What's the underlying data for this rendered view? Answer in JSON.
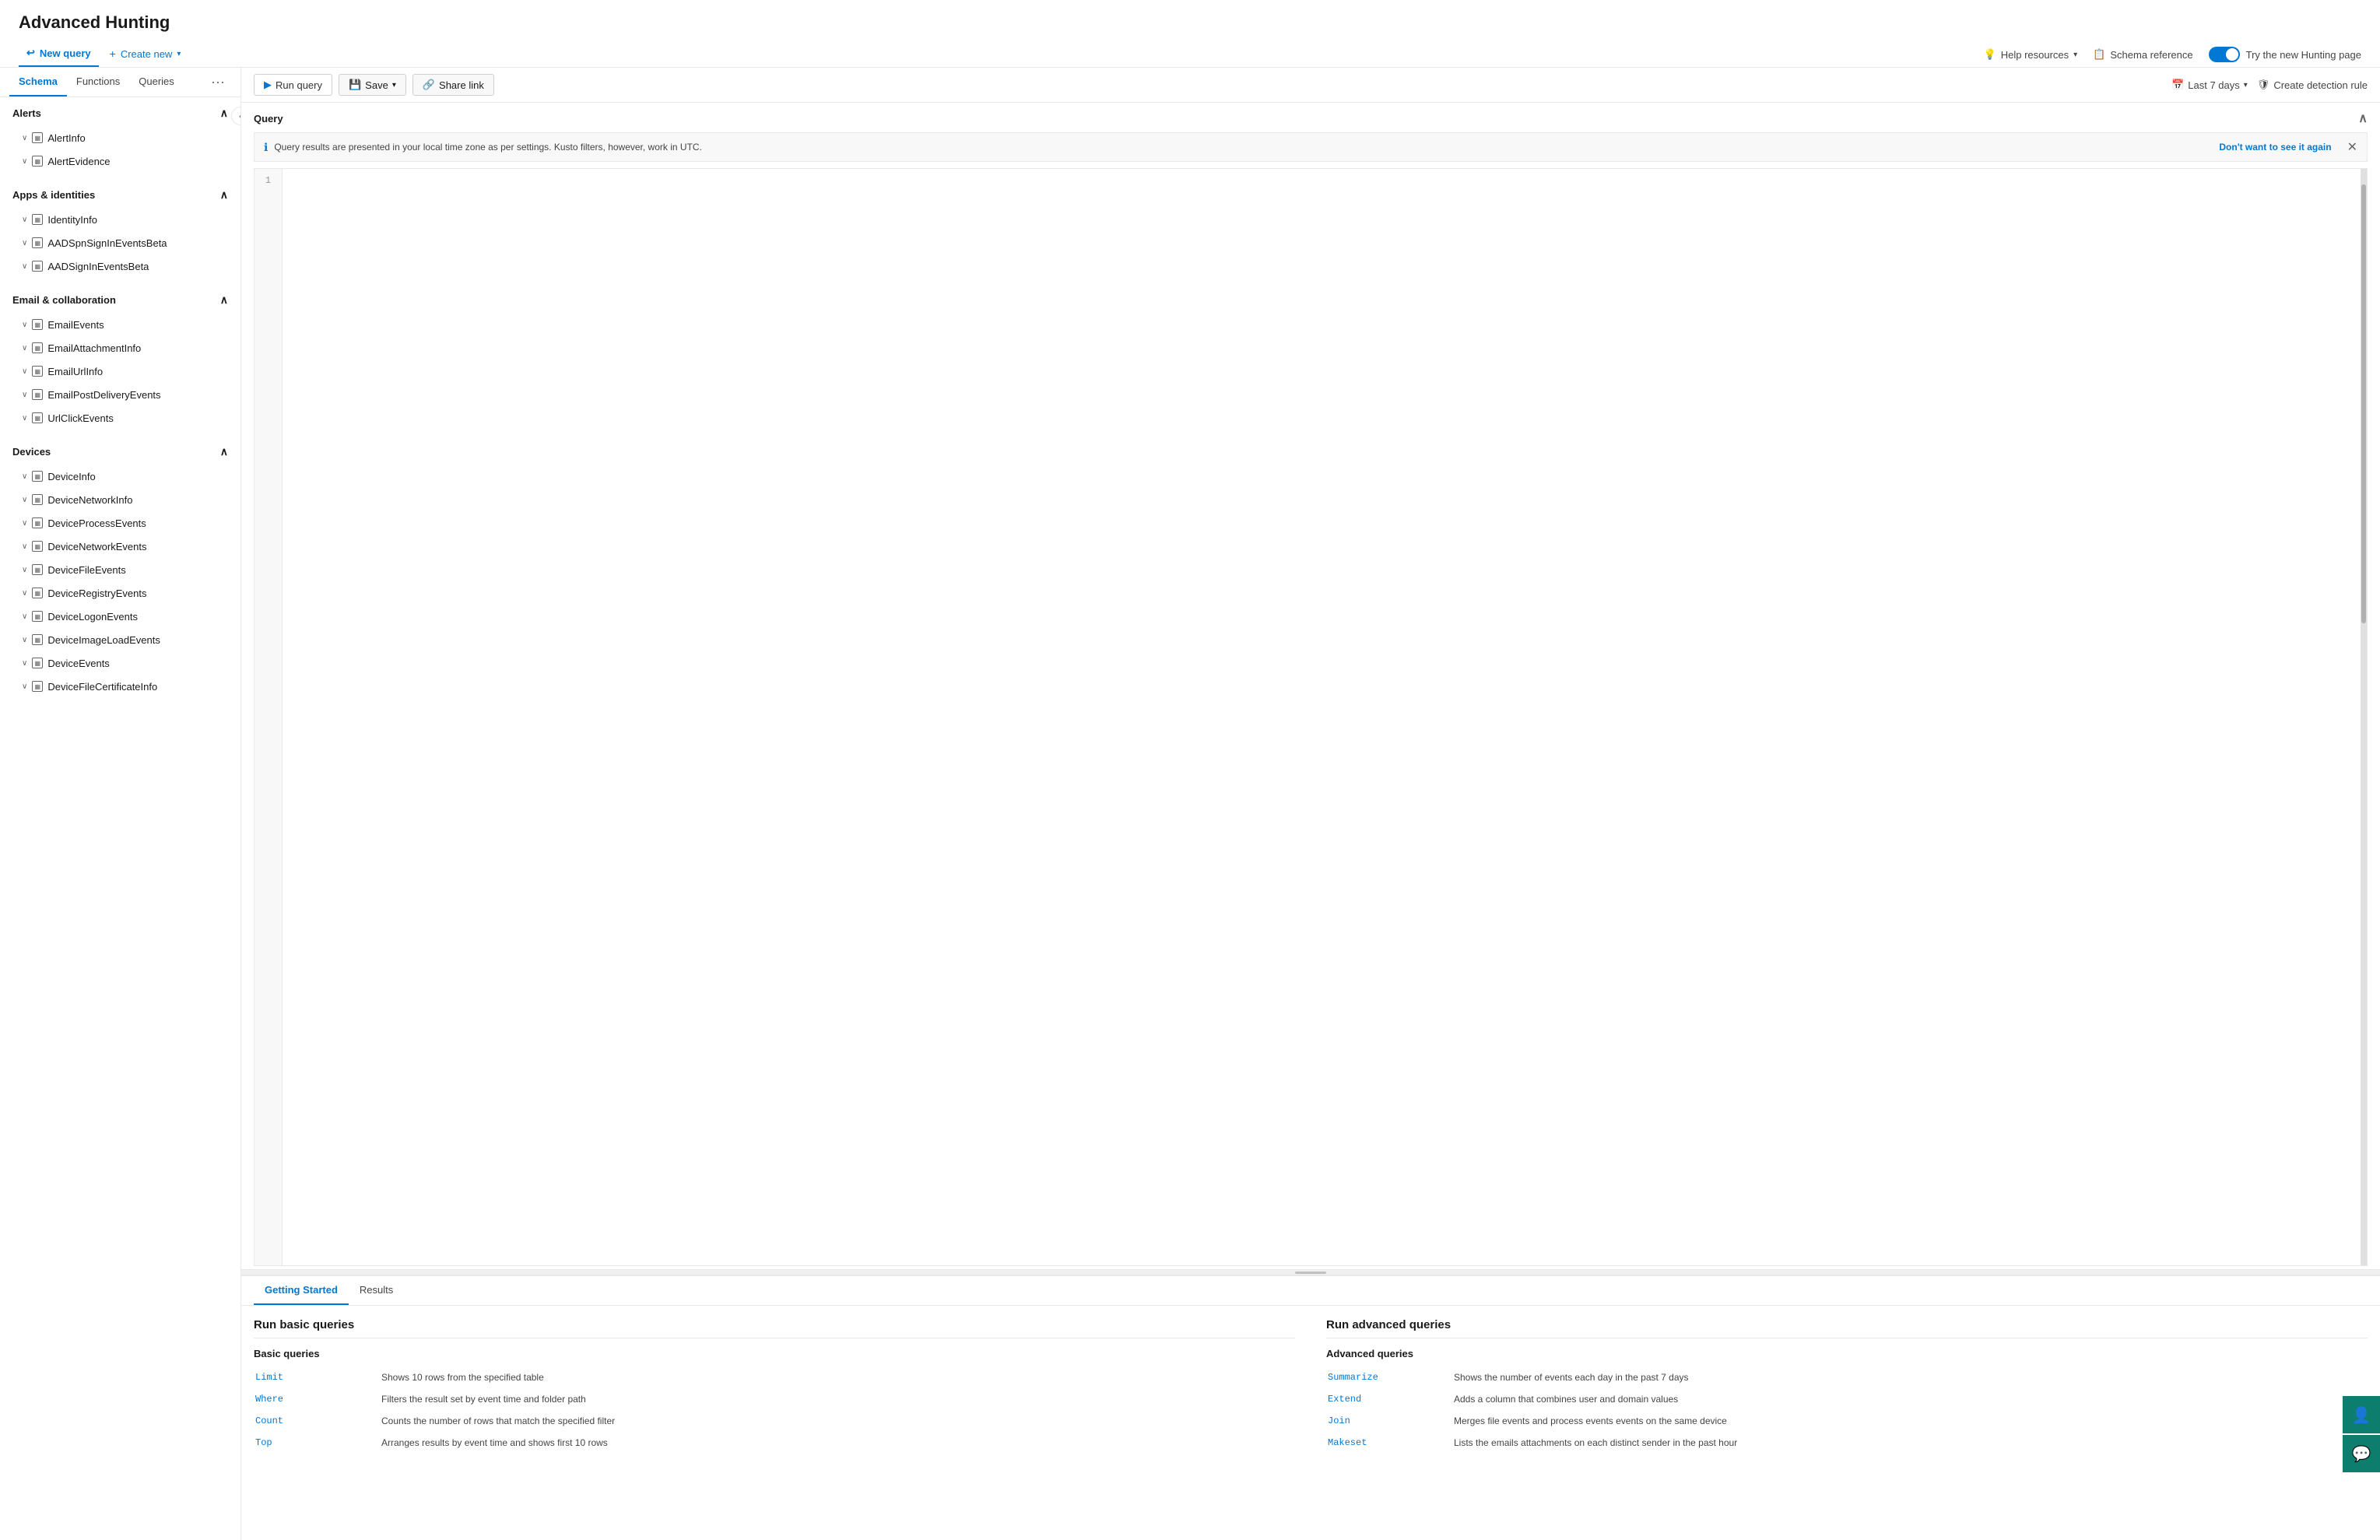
{
  "app": {
    "title": "Advanced Hunting"
  },
  "header": {
    "nav_tabs": [
      {
        "id": "new-query",
        "label": "New query",
        "icon": "↩",
        "active": true
      },
      {
        "id": "create-new",
        "label": "Create new",
        "icon": "+",
        "active": false
      }
    ],
    "right_items": [
      {
        "id": "help",
        "label": "Help resources",
        "icon": "💡"
      },
      {
        "id": "schema",
        "label": "Schema reference",
        "icon": "📋"
      },
      {
        "id": "new-hunting",
        "label": "Try the new Hunting page",
        "toggle": true
      }
    ],
    "time_range": "Last 7 days",
    "create_detection": "Create detection rule"
  },
  "toolbar": {
    "run_query": "Run query",
    "save": "Save",
    "share_link": "Share link",
    "time_range": "Last 7 days",
    "create_detection": "Create detection rule"
  },
  "query_section": {
    "label": "Query",
    "notification": "Query results are presented in your local time zone as per settings. Kusto filters, however, work in UTC.",
    "dismiss_text": "Don't want to see it again",
    "line_number": "1"
  },
  "sidebar": {
    "tabs": [
      {
        "id": "schema",
        "label": "Schema",
        "active": true
      },
      {
        "id": "functions",
        "label": "Functions",
        "active": false
      },
      {
        "id": "queries",
        "label": "Queries",
        "active": false
      }
    ],
    "groups": [
      {
        "id": "alerts",
        "label": "Alerts",
        "expanded": true,
        "items": [
          {
            "id": "alert-info",
            "label": "AlertInfo"
          },
          {
            "id": "alert-evidence",
            "label": "AlertEvidence"
          }
        ]
      },
      {
        "id": "apps-identities",
        "label": "Apps & identities",
        "expanded": true,
        "items": [
          {
            "id": "identity-info",
            "label": "IdentityInfo"
          },
          {
            "id": "aad-spn-signin",
            "label": "AADSpnSignInEventsBeta"
          },
          {
            "id": "aad-signin",
            "label": "AADSignInEventsBeta"
          }
        ]
      },
      {
        "id": "email-collab",
        "label": "Email & collaboration",
        "expanded": true,
        "items": [
          {
            "id": "email-events",
            "label": "EmailEvents"
          },
          {
            "id": "email-attachment",
            "label": "EmailAttachmentInfo"
          },
          {
            "id": "email-url",
            "label": "EmailUrlInfo"
          },
          {
            "id": "email-postdelivery",
            "label": "EmailPostDeliveryEvents"
          },
          {
            "id": "url-click",
            "label": "UrlClickEvents"
          }
        ]
      },
      {
        "id": "devices",
        "label": "Devices",
        "expanded": true,
        "items": [
          {
            "id": "device-info",
            "label": "DeviceInfo"
          },
          {
            "id": "device-network-info",
            "label": "DeviceNetworkInfo"
          },
          {
            "id": "device-process-events",
            "label": "DeviceProcessEvents"
          },
          {
            "id": "device-network-events",
            "label": "DeviceNetworkEvents"
          },
          {
            "id": "device-file-events",
            "label": "DeviceFileEvents"
          },
          {
            "id": "device-registry-events",
            "label": "DeviceRegistryEvents"
          },
          {
            "id": "device-logon-events",
            "label": "DeviceLogonEvents"
          },
          {
            "id": "device-image-load",
            "label": "DeviceImageLoadEvents"
          },
          {
            "id": "device-events",
            "label": "DeviceEvents"
          },
          {
            "id": "device-file-cert",
            "label": "DeviceFileCertificateInfo"
          }
        ]
      }
    ]
  },
  "results": {
    "tabs": [
      {
        "id": "getting-started",
        "label": "Getting Started",
        "active": true
      },
      {
        "id": "results-tab",
        "label": "Results",
        "active": false
      }
    ],
    "getting_started": {
      "basic": {
        "title": "Run basic queries",
        "subtitle": "Basic queries",
        "items": [
          {
            "cmd": "Limit",
            "desc": "Shows 10 rows from the specified table"
          },
          {
            "cmd": "Where",
            "desc": "Filters the result set by event time and folder path"
          },
          {
            "cmd": "Count",
            "desc": "Counts the number of rows that match the specified filter"
          },
          {
            "cmd": "Top",
            "desc": "Arranges results by event time and shows first 10 rows"
          }
        ]
      },
      "advanced": {
        "title": "Run advanced queries",
        "subtitle": "Advanced queries",
        "items": [
          {
            "cmd": "Summarize",
            "desc": "Shows the number of events each day in the past 7 days"
          },
          {
            "cmd": "Extend",
            "desc": "Adds a column that combines user and domain values"
          },
          {
            "cmd": "Join",
            "desc": "Merges file events and process events events on the same device"
          },
          {
            "cmd": "Makeset",
            "desc": "Lists the emails attachments on each distinct sender in the past hour"
          }
        ]
      }
    }
  }
}
